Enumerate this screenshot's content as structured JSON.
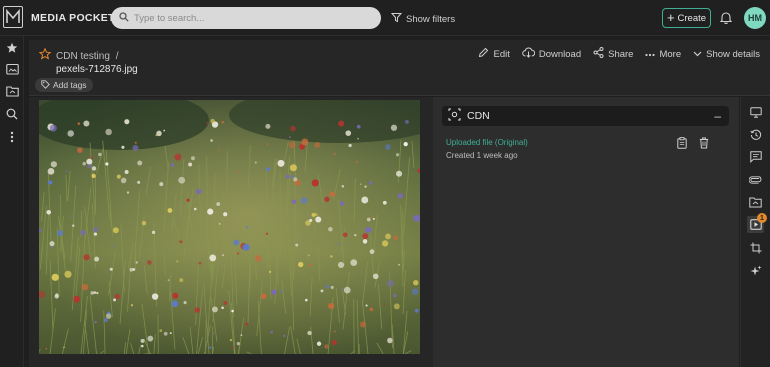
{
  "app": {
    "title": "MEDIA POCKET"
  },
  "search": {
    "placeholder": "Type to search..."
  },
  "toolbar": {
    "filters_label": "Show filters",
    "create_label": "Create"
  },
  "user": {
    "initials": "HM"
  },
  "breadcrumb": {
    "folder": "CDN testing",
    "separator": "/"
  },
  "asset": {
    "filename": "pexels-712876.jpg",
    "add_tags_label": "Add tags"
  },
  "actions": {
    "edit": "Edit",
    "download": "Download",
    "share": "Share",
    "more": "More",
    "show_details": "Show details"
  },
  "panel": {
    "title": "CDN",
    "collapse_symbol": "–",
    "file_link": "Uploaded file (Original)",
    "created": "Created 1 week ago"
  },
  "rail": {
    "badge_count": "1"
  },
  "colors": {
    "accent": "#3fae94",
    "badge": "#e28a2b",
    "star": "#e28a2b"
  }
}
